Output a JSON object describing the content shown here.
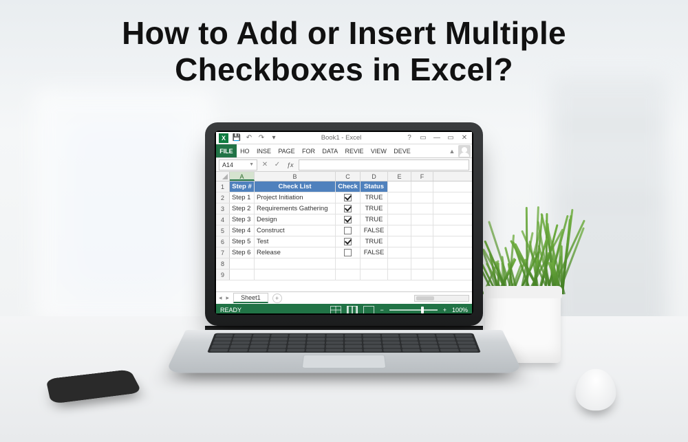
{
  "headline_line1": "How to Add or Insert Multiple",
  "headline_line2": "Checkboxes in Excel?",
  "window": {
    "title": "Book1 - Excel",
    "help": "?",
    "restore": "▭",
    "min": "—",
    "close": "✕",
    "ribbon_collapse": "▲"
  },
  "qat": {
    "save": "💾",
    "undo": "↶",
    "redo": "↷",
    "custom": "▾"
  },
  "tabs": [
    "FILE",
    "HO",
    "INSE",
    "PAGE",
    "FOR",
    "DATA",
    "REVIE",
    "VIEW",
    "DEVE"
  ],
  "active_tab_index": 0,
  "namebox": {
    "value": "A14"
  },
  "formula_bar": {
    "cancel": "✕",
    "enter": "✓",
    "fx": "ƒx",
    "value": ""
  },
  "columns": [
    "A",
    "B",
    "C",
    "D",
    "E",
    "F"
  ],
  "selected_column_index": 0,
  "rows_count": 9,
  "headers": {
    "A": "Step #",
    "B": "Check List",
    "C": "Check",
    "D": "Status"
  },
  "data_rows": [
    {
      "n": 2,
      "step": "Step 1",
      "item": "Project Initiation",
      "checked": true,
      "status": "TRUE"
    },
    {
      "n": 3,
      "step": "Step 2",
      "item": "Requirements Gathering",
      "checked": true,
      "status": "TRUE"
    },
    {
      "n": 4,
      "step": "Step 3",
      "item": "Design",
      "checked": true,
      "status": "TRUE"
    },
    {
      "n": 5,
      "step": "Step 4",
      "item": "Construct",
      "checked": false,
      "status": "FALSE"
    },
    {
      "n": 6,
      "step": "Step 5",
      "item": "Test",
      "checked": true,
      "status": "TRUE"
    },
    {
      "n": 7,
      "step": "Step 6",
      "item": "Release",
      "checked": false,
      "status": "FALSE"
    }
  ],
  "sheet": {
    "name": "Sheet1",
    "add": "+",
    "nav_prev": "◂",
    "nav_next": "▸"
  },
  "status": {
    "ready": "READY",
    "zoom": "100%",
    "minus": "−",
    "plus": "+"
  }
}
